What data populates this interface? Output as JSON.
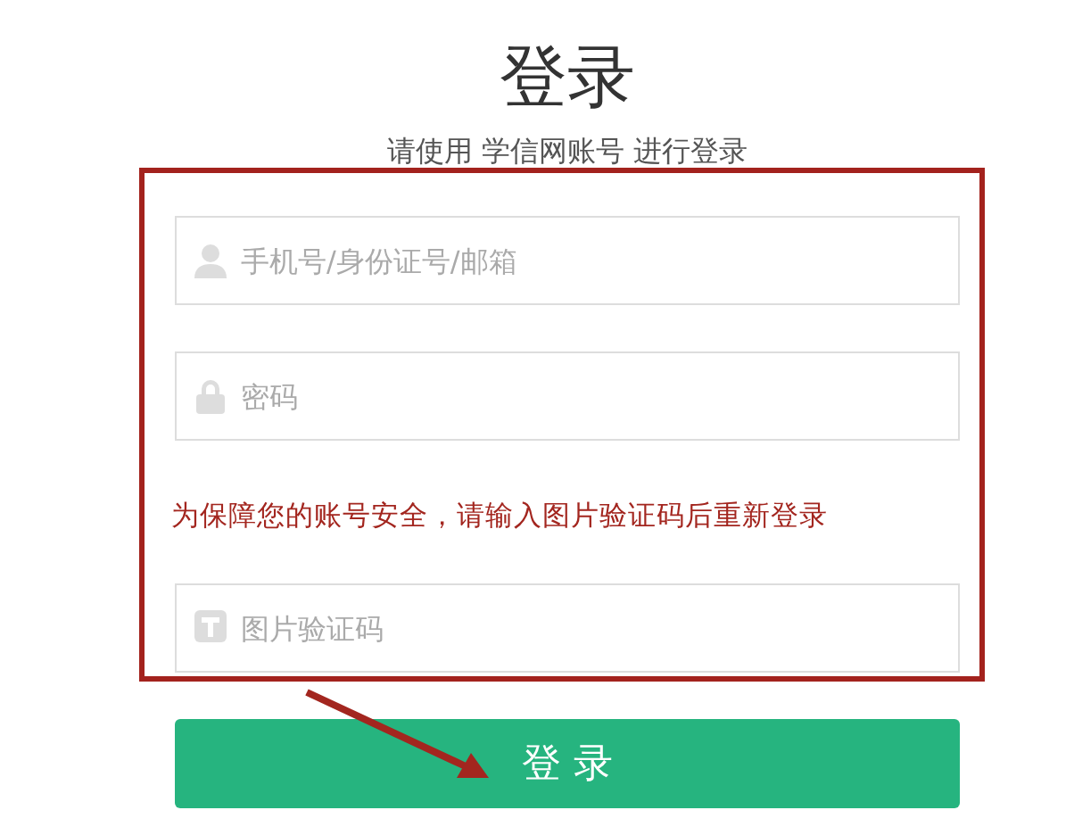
{
  "title": "登录",
  "subtitle": "请使用 学信网账号 进行登录",
  "fields": [
    {
      "kind": "user",
      "placeholder": "手机号/身份证号/邮箱"
    },
    {
      "kind": "lock",
      "placeholder": "密码"
    },
    {
      "kind": "captcha",
      "placeholder": "图片验证码"
    }
  ],
  "warning": "为保障您的账号安全，请输入图片验证码后重新登录",
  "login_button": "登 录"
}
